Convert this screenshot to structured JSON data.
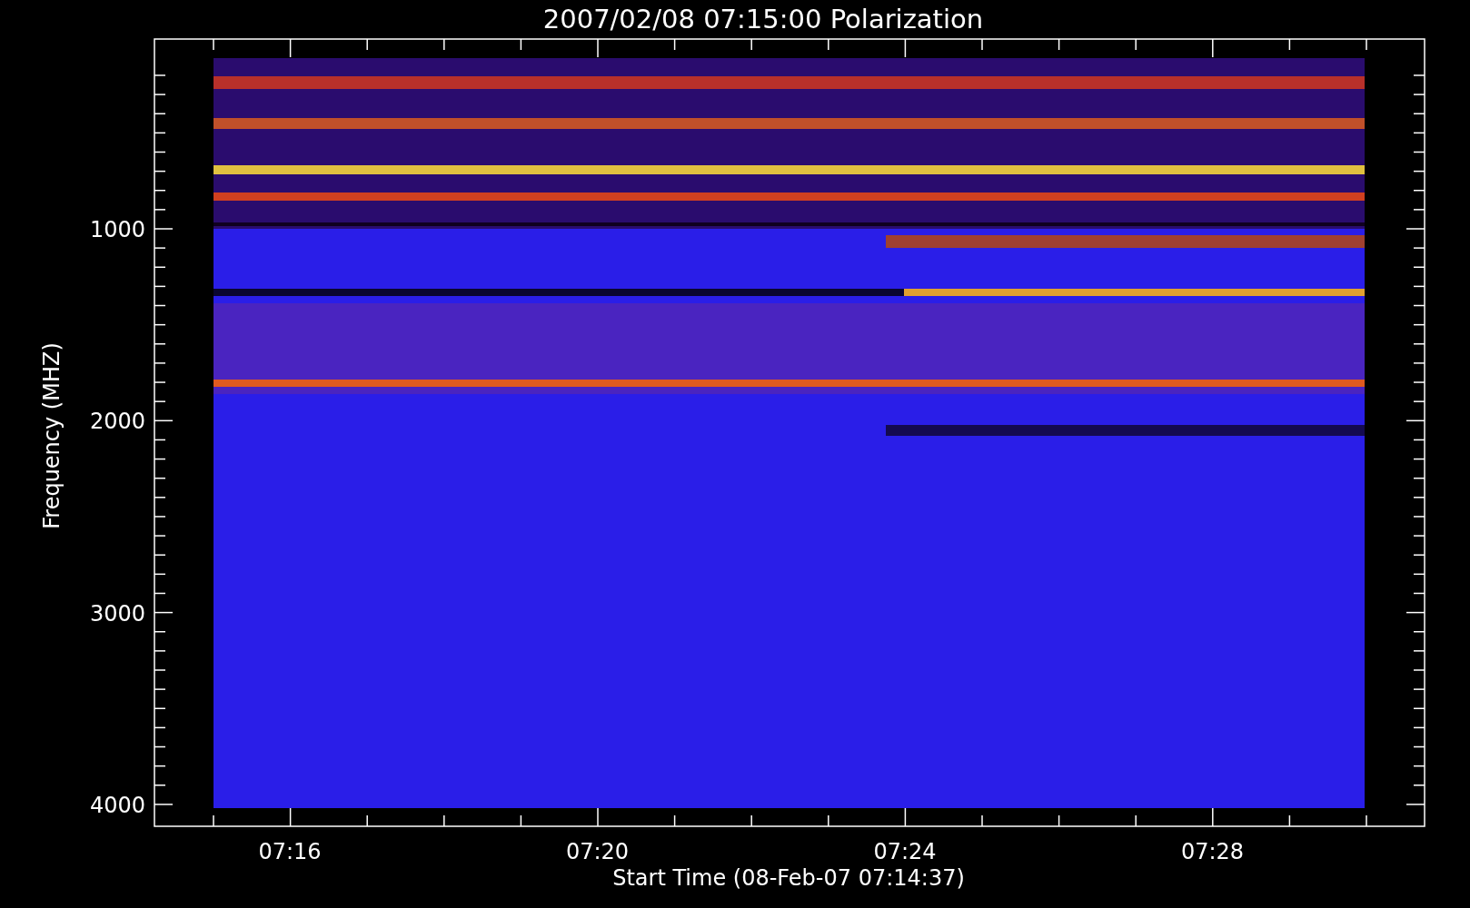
{
  "title": "2007/02/08 07:15:00 Polarization",
  "y_axis": {
    "label": "Frequency (MHZ)",
    "ticks": [
      "1000",
      "2000",
      "3000",
      "4000"
    ]
  },
  "x_axis": {
    "label": "Start Time (08-Feb-07 07:14:37)",
    "ticks": [
      "07:16",
      "07:20",
      "07:24",
      "07:28"
    ]
  }
}
